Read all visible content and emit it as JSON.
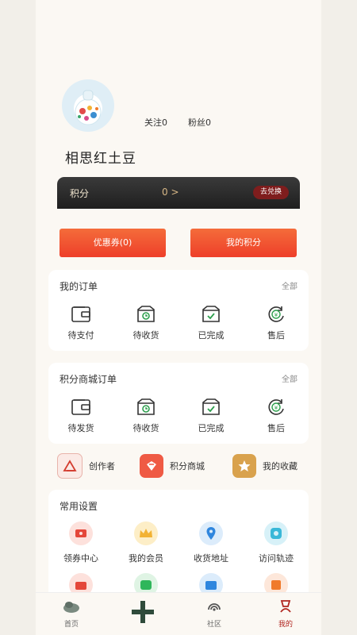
{
  "profile": {
    "username": "相思红土豆",
    "following_label": "关注0",
    "followers_label": "粉丝0"
  },
  "points_card": {
    "label": "积分",
    "value": "0 >",
    "redeem_button": "去兑换"
  },
  "buttons": {
    "coupons": "优惠券(0)",
    "my_points": "我的积分"
  },
  "orders": {
    "title": "我的订单",
    "more": "全部",
    "items": [
      {
        "label": "待支付",
        "icon": "wallet-icon"
      },
      {
        "label": "待收货",
        "icon": "box-clock-icon"
      },
      {
        "label": "已完成",
        "icon": "box-check-icon"
      },
      {
        "label": "售后",
        "icon": "yen-refresh-icon"
      }
    ]
  },
  "mall_orders": {
    "title": "积分商城订单",
    "more": "全部",
    "items": [
      {
        "label": "待发货",
        "icon": "wallet-icon"
      },
      {
        "label": "待收货",
        "icon": "box-clock-icon"
      },
      {
        "label": "已完成",
        "icon": "box-check-icon"
      },
      {
        "label": "售后",
        "icon": "yen-refresh-icon"
      }
    ]
  },
  "quick_links": [
    {
      "label": "创作者",
      "icon": "creator-icon"
    },
    {
      "label": "积分商城",
      "icon": "points-mall-icon"
    },
    {
      "label": "我的收藏",
      "icon": "star-icon"
    }
  ],
  "settings": {
    "title": "常用设置",
    "items": [
      {
        "label": "领券中心",
        "icon": "ticket-icon"
      },
      {
        "label": "我的会员",
        "icon": "crown-icon"
      },
      {
        "label": "收货地址",
        "icon": "location-icon"
      },
      {
        "label": "访问轨迹",
        "icon": "footprint-icon"
      }
    ]
  },
  "tabbar": {
    "items": [
      {
        "label": "首页",
        "icon": "home-icon"
      },
      {
        "label": "",
        "icon": "plus-icon"
      },
      {
        "label": "社区",
        "icon": "community-icon"
      },
      {
        "label": "我的",
        "icon": "me-icon"
      }
    ]
  },
  "colors": {
    "accent_red": "#b0251f",
    "orange_gradient_top": "#f46c3a",
    "orange_gradient_bottom": "#ee3f2a",
    "dark_card": "#1f1f1f",
    "redeem_badge": "#7f1d1d",
    "tab_plus_green": "#2f4b3b"
  }
}
